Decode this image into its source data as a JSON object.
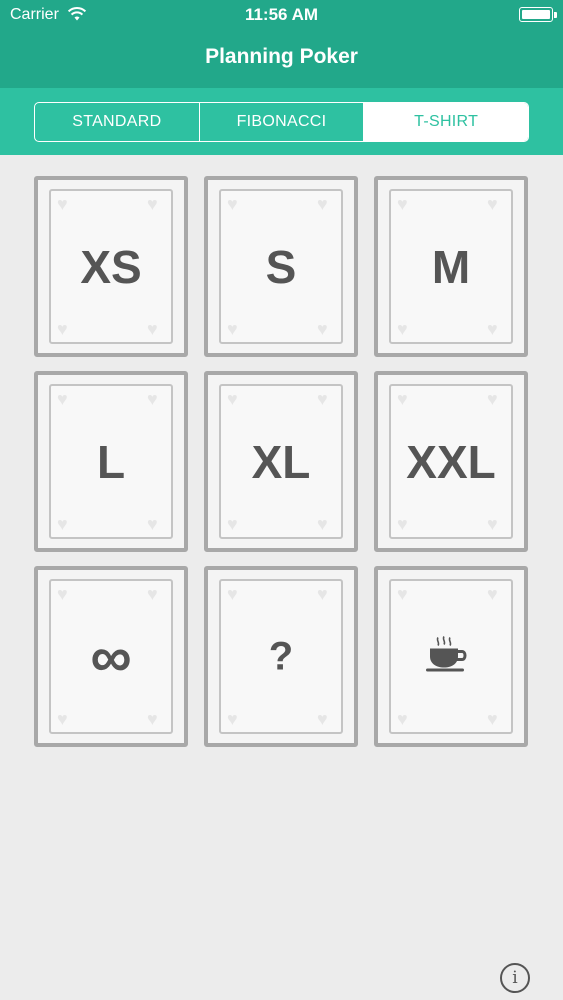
{
  "status_bar": {
    "carrier": "Carrier",
    "time": "11:56 AM"
  },
  "nav": {
    "title": "Planning Poker"
  },
  "segments": [
    {
      "label": "STANDARD",
      "selected": false
    },
    {
      "label": "FIBONACCI",
      "selected": false
    },
    {
      "label": "T-SHIRT",
      "selected": true
    }
  ],
  "cards": [
    {
      "label": "XS"
    },
    {
      "label": "S"
    },
    {
      "label": "M"
    },
    {
      "label": "L"
    },
    {
      "label": "XL"
    },
    {
      "label": "XXL"
    },
    {
      "label": "∞",
      "icon": "infinity-icon"
    },
    {
      "label": "?"
    },
    {
      "label": "",
      "icon": "coffee-cup-icon"
    }
  ],
  "info": {
    "label": "i"
  },
  "colors": {
    "header": "#22a88a",
    "segment_bar": "#2ec1a1",
    "card_border": "#a8a8a8",
    "background": "#ececec"
  }
}
